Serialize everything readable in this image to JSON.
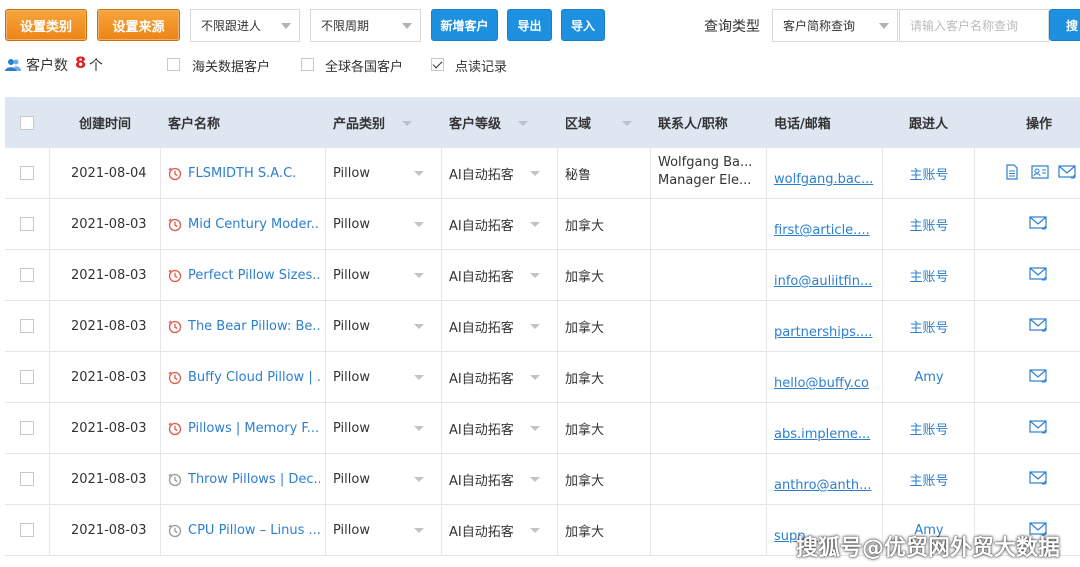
{
  "toolbar": {
    "btn_category": "设置类别",
    "btn_source": "设置来源",
    "select_follower": "不限跟进人",
    "select_period": "不限周期",
    "btn_add": "新增客户",
    "btn_export": "导出",
    "btn_import": "导入",
    "query_type_label": "查询类型",
    "query_type_value": "客户简称查询",
    "search_placeholder": "请输入客户名称查询",
    "btn_search": "搜"
  },
  "filters": {
    "count_label": "客户数",
    "count_value": "8",
    "count_unit": "个",
    "customs_label": "海关数据客户",
    "customs_checked": false,
    "global_label": "全球各国客户",
    "global_checked": false,
    "read_label": "点读记录",
    "read_checked": true
  },
  "table": {
    "headers": {
      "created": "创建时间",
      "name": "客户名称",
      "product": "产品类别",
      "level": "客户等级",
      "region": "区域",
      "contact": "联系人/职称",
      "phone": "电话/邮箱",
      "follower": "跟进人",
      "ops": "操作"
    },
    "rows": [
      {
        "date": "2021-08-04",
        "name": "FLSMIDTH S.A.C.",
        "product": "Pillow",
        "level": "AI自动拓客",
        "region": "秘鲁",
        "contact1": "Wolfgang Ba...",
        "contact2": "Manager Ele...",
        "email": "wolfgang.bac...",
        "follower": "主账号",
        "clock": "red",
        "ops": [
          "doc",
          "card",
          "mail"
        ]
      },
      {
        "date": "2021-08-03",
        "name": "Mid Century Moder...",
        "product": "Pillow",
        "level": "AI自动拓客",
        "region": "加拿大",
        "contact1": "",
        "contact2": "",
        "email": "first@article....",
        "follower": "主账号",
        "clock": "red",
        "ops": [
          "mail"
        ]
      },
      {
        "date": "2021-08-03",
        "name": "Perfect Pillow Sizes...",
        "product": "Pillow",
        "level": "AI自动拓客",
        "region": "加拿大",
        "contact1": "",
        "contact2": "",
        "email": "info@auliitfin...",
        "follower": "主账号",
        "clock": "red",
        "ops": [
          "mail"
        ]
      },
      {
        "date": "2021-08-03",
        "name": "The Bear Pillow: Be...",
        "product": "Pillow",
        "level": "AI自动拓客",
        "region": "加拿大",
        "contact1": "",
        "contact2": "",
        "email": "partnerships....",
        "follower": "主账号",
        "clock": "red",
        "ops": [
          "mail"
        ]
      },
      {
        "date": "2021-08-03",
        "name": "Buffy Cloud Pillow | ...",
        "product": "Pillow",
        "level": "AI自动拓客",
        "region": "加拿大",
        "contact1": "",
        "contact2": "",
        "email": "hello@buffy.co",
        "follower": "Amy",
        "clock": "red",
        "ops": [
          "mail"
        ]
      },
      {
        "date": "2021-08-03",
        "name": "Pillows | Memory F...",
        "product": "Pillow",
        "level": "AI自动拓客",
        "region": "加拿大",
        "contact1": "",
        "contact2": "",
        "email": "abs.impleme...",
        "follower": "主账号",
        "clock": "red",
        "ops": [
          "mail"
        ]
      },
      {
        "date": "2021-08-03",
        "name": "Throw Pillows | Dec...",
        "product": "Pillow",
        "level": "AI自动拓客",
        "region": "加拿大",
        "contact1": "",
        "contact2": "",
        "email": "anthro@anth...",
        "follower": "主账号",
        "clock": "gray",
        "ops": [
          "mail"
        ]
      },
      {
        "date": "2021-08-03",
        "name": "CPU Pillow – Linus ...",
        "product": "Pillow",
        "level": "AI自动拓客",
        "region": "加拿大",
        "contact1": "",
        "contact2": "",
        "email": "supp...",
        "follower": "Amy",
        "clock": "gray",
        "ops": [
          "mail"
        ]
      }
    ]
  },
  "watermark": "搜狐号@优贸网外贸大数据",
  "colors": {
    "orange": "#ec8418",
    "blue": "#1e90e0",
    "link": "#2c7fd0",
    "header_bg": "#dde6f1",
    "count_red": "#e02020"
  }
}
